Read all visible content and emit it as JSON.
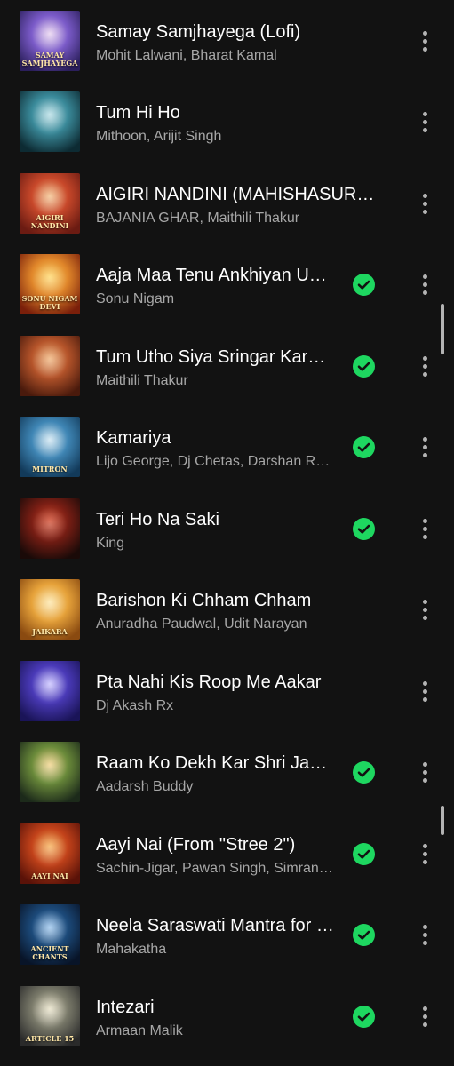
{
  "tracks": [
    {
      "title": "Samay Samjhayega (Lofi)",
      "artist": "Mohit Lalwani, Bharat Kamal",
      "downloaded": false,
      "art_icon": "album-art-samay-samjhayega",
      "art_caption": "Samay\nSamjhayega",
      "colors": [
        "#2b1f5c",
        "#7b5bc9",
        "#e8d2f0"
      ]
    },
    {
      "title": "Tum Hi Ho",
      "artist": "Mithoon, Arijit Singh",
      "downloaded": false,
      "art_icon": "album-art-aashiqui-2",
      "art_caption": "",
      "colors": [
        "#0d2b33",
        "#3a8a9a",
        "#b7dfe6"
      ]
    },
    {
      "title": "AIGIRI NANDINI (MAHISHASURMARDINI STOTRAM)",
      "artist": "BAJANIA GHAR, Maithili Thakur",
      "downloaded": false,
      "art_icon": "album-art-aigiri-nandini",
      "art_caption": "Aigiri\nNandini",
      "colors": [
        "#6b1b12",
        "#c8482a",
        "#f3c08a"
      ]
    },
    {
      "title": "Aaja Maa Tenu Ankhiyan Udeek Diyan",
      "artist": "Sonu Nigam",
      "downloaded": true,
      "art_icon": "album-art-sonu-nigam-devi-bhajans",
      "art_caption": "Sonu Nigam\nDevi",
      "colors": [
        "#7a1f0a",
        "#e0862a",
        "#ffd86b"
      ]
    },
    {
      "title": "Tum Utho Siya Sringar Karo Na",
      "artist": "Maithili Thakur",
      "downloaded": true,
      "art_icon": "album-art-tum-utho-siya",
      "art_caption": "",
      "colors": [
        "#4a1a0c",
        "#b5542a",
        "#f0b37a"
      ]
    },
    {
      "title": "Kamariya",
      "artist": "Lijo George, Dj Chetas, Darshan Raval",
      "downloaded": true,
      "art_icon": "album-art-mitron",
      "art_caption": "Mitron",
      "colors": [
        "#123a5a",
        "#3f86b5",
        "#cfe6f2"
      ]
    },
    {
      "title": "Teri Ho Na Saki",
      "artist": "King",
      "downloaded": true,
      "art_icon": "album-art-teri-ho-na-saki",
      "art_caption": "",
      "colors": [
        "#1a0a08",
        "#7a1e14",
        "#d24a2e"
      ]
    },
    {
      "title": "Barishon Ki Chham Chham",
      "artist": "Anuradha Paudwal, Udit Narayan",
      "downloaded": false,
      "art_icon": "album-art-jaikara",
      "art_caption": "Jaikara",
      "colors": [
        "#8a4a10",
        "#e6a23a",
        "#fde6a8"
      ]
    },
    {
      "title": "Pta Nahi Kis Roop Me Aakar",
      "artist": "Dj Akash Rx",
      "downloaded": false,
      "art_icon": "album-art-pta-nahi-kis-roop",
      "art_caption": "",
      "colors": [
        "#1a1458",
        "#4a3ab8",
        "#c9c2ff"
      ]
    },
    {
      "title": "Raam Ko Dekh Kar Shri Janak Nandini",
      "artist": "Aadarsh Buddy",
      "downloaded": true,
      "art_icon": "album-art-raam-ko-dekh-kar",
      "art_caption": "",
      "colors": [
        "#1c2a1a",
        "#6a8a3a",
        "#f2d48a"
      ]
    },
    {
      "title": "Aayi Nai (From \"Stree 2\")",
      "artist": "Sachin-Jigar, Pawan Singh, Simran Choudhary",
      "downloaded": true,
      "art_icon": "album-art-aayi-nai",
      "art_caption": "Aayi nai",
      "colors": [
        "#5a1208",
        "#c2421a",
        "#f7b15a"
      ]
    },
    {
      "title": "Neela Saraswati Mantra for Wisdom",
      "artist": "Mahakatha",
      "downloaded": true,
      "art_icon": "album-art-ancient-chants",
      "art_caption": "Ancient\nChants",
      "colors": [
        "#081428",
        "#1c4a7a",
        "#9cc6ee"
      ]
    },
    {
      "title": "Intezari",
      "artist": "Armaan Malik",
      "downloaded": true,
      "art_icon": "album-art-article-15",
      "art_caption": "Article 15",
      "colors": [
        "#2a2a2a",
        "#7a7a6a",
        "#e8e2c8"
      ]
    }
  ],
  "icons": {
    "downloaded": "downloaded-check-icon",
    "more": "more-options-icon"
  },
  "theme": {
    "background": "#121212",
    "accent": "#1ed760",
    "secondary_text": "#a7a7a7"
  }
}
